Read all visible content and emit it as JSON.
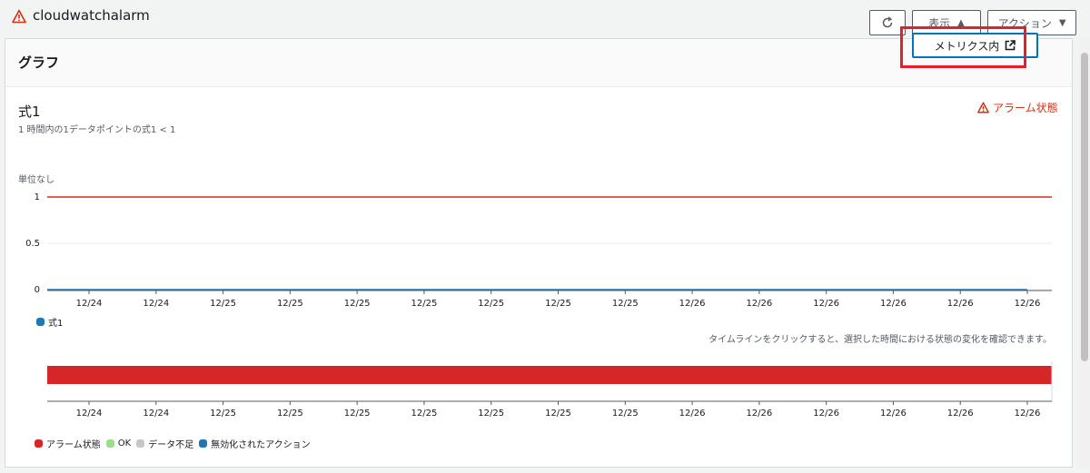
{
  "header": {
    "title": "cloudwatchalarm",
    "title_icon": "warning-icon",
    "view_label": "表示",
    "actions_label": "アクション",
    "refresh_icon": "refresh-icon"
  },
  "dropdown": {
    "item_label": "メトリクス内",
    "item_icon": "external-link-icon"
  },
  "panel": {
    "title": "グラフ",
    "expression_title": "式1",
    "expression_subtitle": "1 時間内の1データポイントの式1 < 1",
    "alarm_state_label": "アラーム状態"
  },
  "chart_data": [
    {
      "type": "line",
      "title": "",
      "ylabel": "単位なし",
      "ylim": [
        0,
        1
      ],
      "yticks": [
        "1",
        "0.5",
        "0"
      ],
      "x": [
        "12/24",
        "12/24",
        "12/25",
        "12/25",
        "12/25",
        "12/25",
        "12/25",
        "12/25",
        "12/25",
        "12/26",
        "12/26",
        "12/26",
        "12/26",
        "12/26",
        "12/26"
      ],
      "series": [
        {
          "name": "式1",
          "color": "#1f77b4",
          "values": [
            0,
            0,
            0,
            0,
            0,
            0,
            0,
            0,
            0,
            0,
            0,
            0,
            0,
            0,
            0
          ]
        }
      ],
      "threshold": {
        "value": 1,
        "color": "#d13212"
      },
      "legend": [
        {
          "label": "式1",
          "color": "#1f77b4"
        }
      ],
      "grid": true
    },
    {
      "type": "timeline",
      "note": "タイムラインをクリックすると、選択した時間における状態の変化を確認できます。",
      "x": [
        "12/24",
        "12/24",
        "12/25",
        "12/25",
        "12/25",
        "12/25",
        "12/25",
        "12/25",
        "12/25",
        "12/26",
        "12/26",
        "12/26",
        "12/26",
        "12/26",
        "12/26"
      ],
      "states": [
        {
          "state": "アラーム状態",
          "from": 0,
          "to": 1,
          "color": "#d62728"
        }
      ],
      "legend": [
        {
          "label": "アラーム状態",
          "color": "#d62728"
        },
        {
          "label": "OK",
          "color": "#98df8a"
        },
        {
          "label": "データ不足",
          "color": "#c7c7c7"
        },
        {
          "label": "無効化されたアクション",
          "color": "#1f77b4"
        }
      ]
    }
  ]
}
